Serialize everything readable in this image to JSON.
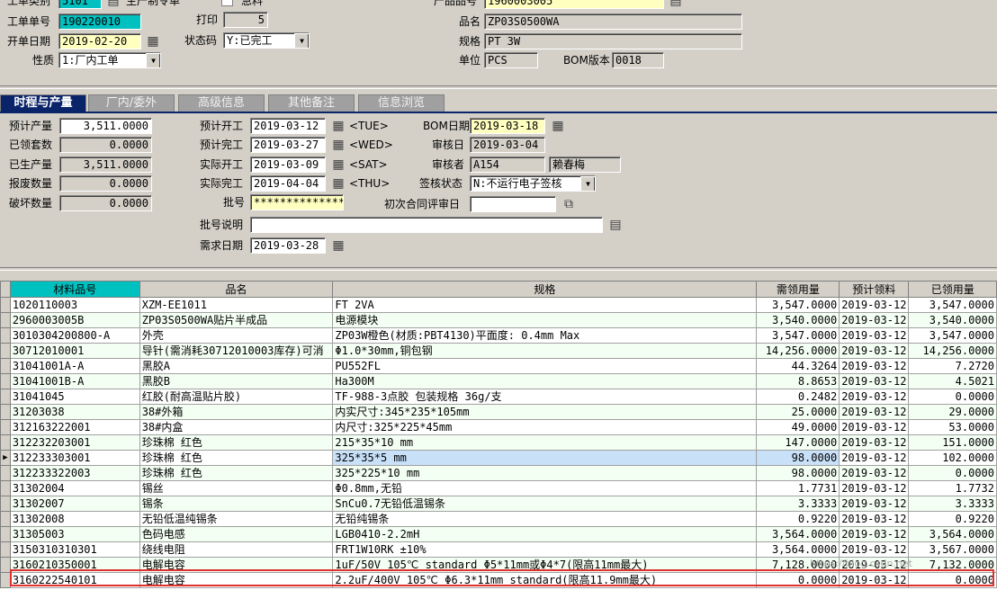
{
  "header": {
    "order_type_label": "工单类别",
    "order_type_value": "5101",
    "order_type_desc": "生产制令单",
    "urgent_label": "急料",
    "order_no_label": "工单单号",
    "order_no_value": "190220010",
    "print_label": "打印",
    "print_value": "5",
    "open_date_label": "开单日期",
    "open_date_value": "2019-02-20",
    "status_label": "状态码",
    "status_value": "Y:已完工",
    "nature_label": "性质",
    "nature_value": "1:厂内工单",
    "product_no_label": "产品品号",
    "product_no_value": "1960003005",
    "product_name_label": "品名",
    "product_name_value": "ZP03S0500WA",
    "spec_label": "规格",
    "spec_value": "PT 3W",
    "unit_label": "单位",
    "unit_value": "PCS",
    "bom_version_label": "BOM版本",
    "bom_version_value": "0018"
  },
  "tabs": [
    {
      "label": "时程与产量",
      "active": true
    },
    {
      "label": "厂内/委外",
      "active": false
    },
    {
      "label": "高级信息",
      "active": false
    },
    {
      "label": "其他备注",
      "active": false
    },
    {
      "label": "信息浏览",
      "active": false
    }
  ],
  "schedule": {
    "planned_qty_label": "预计产量",
    "planned_qty_value": "3,511.0000",
    "received_sets_label": "已领套数",
    "received_sets_value": "0.0000",
    "produced_qty_label": "已生产量",
    "produced_qty_value": "3,511.0000",
    "scrap_qty_label": "报废数量",
    "scrap_qty_value": "0.0000",
    "damaged_qty_label": "破坏数量",
    "damaged_qty_value": "0.0000",
    "plan_start_label": "预计开工",
    "plan_start_value": "2019-03-12",
    "plan_start_day": "<TUE>",
    "plan_finish_label": "预计完工",
    "plan_finish_value": "2019-03-27",
    "plan_finish_day": "<WED>",
    "actual_start_label": "实际开工",
    "actual_start_value": "2019-03-09",
    "actual_start_day": "<SAT>",
    "actual_finish_label": "实际完工",
    "actual_finish_value": "2019-04-04",
    "actual_finish_day": "<THU>",
    "batch_no_label": "批号",
    "batch_no_value": "**************",
    "batch_desc_label": "批号说明",
    "batch_desc_value": "",
    "demand_date_label": "需求日期",
    "demand_date_value": "2019-03-28",
    "bom_date_label": "BOM日期",
    "bom_date_value": "2019-03-18",
    "review_date_label": "审核日",
    "review_date_value": "2019-03-04",
    "reviewer_label": "审核者",
    "reviewer_id": "A154",
    "reviewer_name": "赖春梅",
    "sign_status_label": "签核状态",
    "sign_status_value": "N:不运行电子签核",
    "contract_review_label": "初次合同评审日",
    "contract_review_value": ""
  },
  "grid": {
    "columns": [
      "材料品号",
      "品名",
      "规格",
      "需领用量",
      "预计领料",
      "已领用量"
    ],
    "rows": [
      [
        "1020110003",
        "XZM-EE1011",
        "FT 2VA",
        "3,547.0000",
        "2019-03-12",
        "3,547.0000"
      ],
      [
        "2960003005B",
        "ZP03S0500WA贴片半成品",
        "电源模块",
        "3,540.0000",
        "2019-03-12",
        "3,540.0000"
      ],
      [
        "3010304200800-A",
        "外壳",
        "ZP03W橙色(材质:PBT4130)平面度: 0.4mm Max",
        "3,547.0000",
        "2019-03-12",
        "3,547.0000"
      ],
      [
        "30712010001",
        "导针(需消耗30712010003库存)可消",
        "Φ1.0*30mm,铜包钢",
        "14,256.0000",
        "2019-03-12",
        "14,256.0000"
      ],
      [
        "31041001A-A",
        "黑胶A",
        "PU552FL",
        "44.3264",
        "2019-03-12",
        "7.2720"
      ],
      [
        "31041001B-A",
        "黑胶B",
        "Ha300M",
        "8.8653",
        "2019-03-12",
        "4.5021"
      ],
      [
        "31041045",
        "红胶(耐高温贴片胶)",
        "TF-988-3点胶 包装规格 36g/支",
        "0.2482",
        "2019-03-12",
        "0.0000"
      ],
      [
        "31203038",
        "38#外箱",
        "内实尺寸:345*235*105mm",
        "25.0000",
        "2019-03-12",
        "29.0000"
      ],
      [
        "312163222001",
        "38#内盒",
        "内尺寸:325*225*45mm",
        "49.0000",
        "2019-03-12",
        "53.0000"
      ],
      [
        "312232203001",
        "珍珠棉 红色",
        "215*35*10 mm",
        "147.0000",
        "2019-03-12",
        "151.0000"
      ],
      [
        "312233303001",
        "珍珠棉 红色",
        "325*35*5 mm",
        "98.0000",
        "2019-03-12",
        "102.0000"
      ],
      [
        "312233322003",
        "珍珠棉 红色",
        "325*225*10 mm",
        "98.0000",
        "2019-03-12",
        "0.0000"
      ],
      [
        "31302004",
        "锡丝",
        "Φ0.8mm,无铅",
        "1.7731",
        "2019-03-12",
        "1.7732"
      ],
      [
        "31302007",
        "锡条",
        "SnCu0.7无铅低温锡条",
        "3.3333",
        "2019-03-12",
        "3.3333"
      ],
      [
        "31302008",
        "无铅低温纯锡条",
        "无铅纯锡条",
        "0.9220",
        "2019-03-12",
        "0.9220"
      ],
      [
        "31305003",
        "色码电感",
        "LGB0410-2.2mH",
        "3,564.0000",
        "2019-03-12",
        "3,564.0000"
      ],
      [
        "3150310310301",
        "绕线电阻",
        "FRT1W10RK ±10%",
        "3,564.0000",
        "2019-03-12",
        "3,567.0000"
      ],
      [
        "3160210350001",
        "电解电容",
        "1uF/50V 105℃ standard Φ5*11mm或Φ4*7(限高11mm最大)",
        "7,128.0000",
        "2019-03-12",
        "7,132.0000"
      ],
      [
        "3160222540101",
        "电解电容",
        "2.2uF/400V 105℃ Φ6.3*11mm standard(限高11.9mm最大)",
        "0.0000",
        "2019-03-12",
        "0.0000"
      ]
    ]
  },
  "watermark": "https://blog.csdn.net",
  "colors": {
    "tab_active": "#0a246a",
    "highlight_border": "#e03030",
    "required_field": "#ffffc0",
    "key_field": "#00c0c0"
  }
}
